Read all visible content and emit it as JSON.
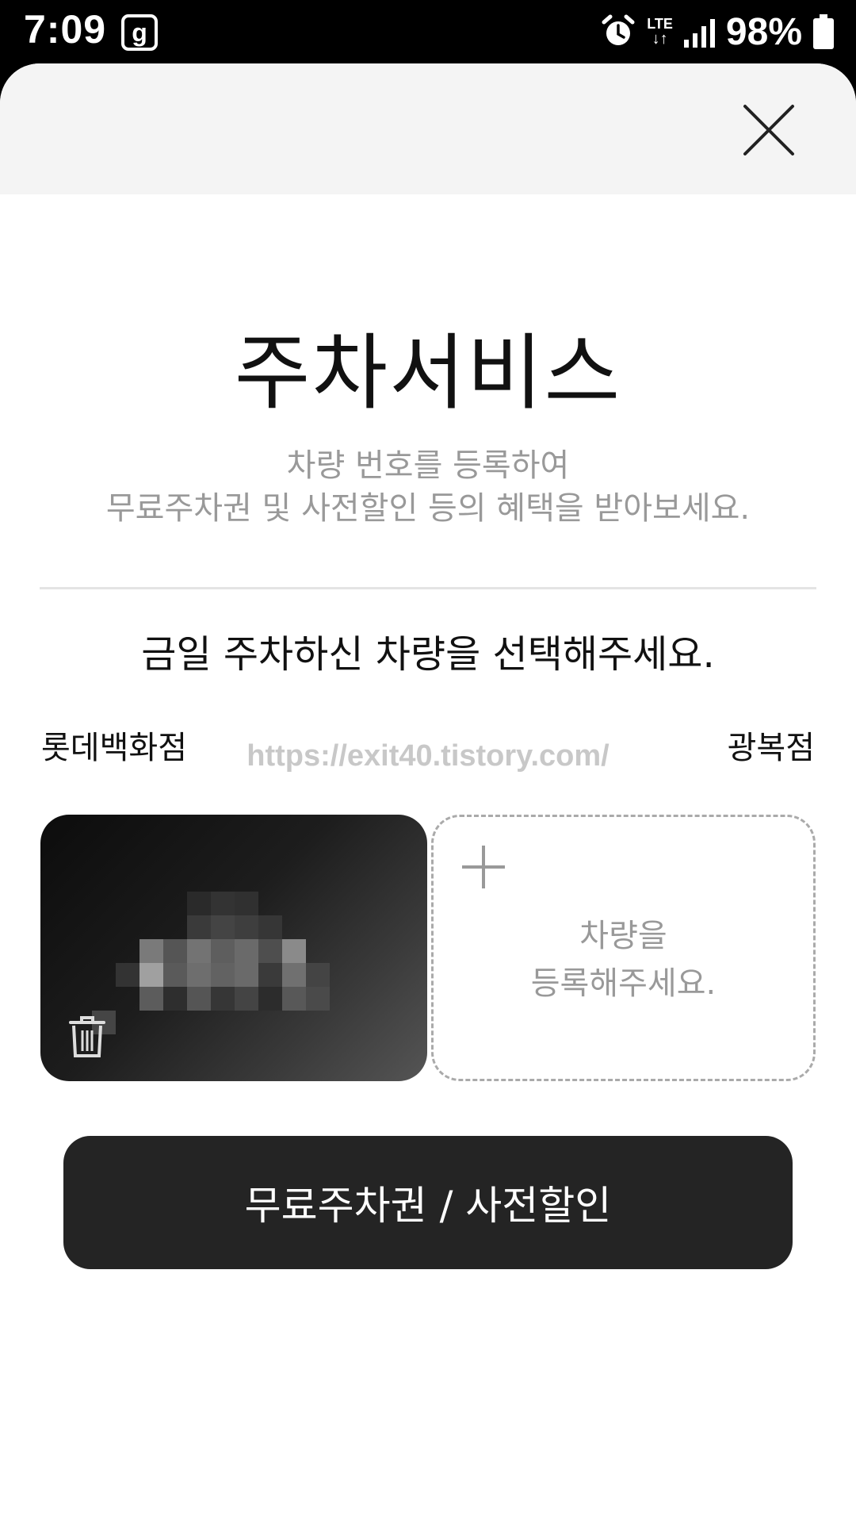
{
  "status_bar": {
    "time": "7:09",
    "app_icon": "g",
    "network": "LTE",
    "battery_percent": "98%",
    "icons": [
      "alarm-icon",
      "lte-icon",
      "signal-icon",
      "battery-icon"
    ]
  },
  "header": {
    "close_icon": "close-icon"
  },
  "main": {
    "title": "주차서비스",
    "subtitle_line1": "차량 번호를 등록하여",
    "subtitle_line2": "무료주차권 및 사전할인 등의 혜택을 받아보세요.",
    "prompt": "금일 주차하신 차량을 선택해주세요.",
    "store_name": "롯데백화점",
    "branch_name": "광복점",
    "watermark": "https://exit40.tistory.com/"
  },
  "cars": {
    "registered_car_icon": "trash-icon",
    "add_car_line1": "차량을",
    "add_car_line2": "등록해주세요.",
    "add_icon": "plus-icon"
  },
  "actions": {
    "primary_label": "무료주차권 / 사전할인"
  },
  "colors": {
    "button_bg": "#242424",
    "header_bg": "#f4f4f4",
    "muted_text": "#999999"
  }
}
